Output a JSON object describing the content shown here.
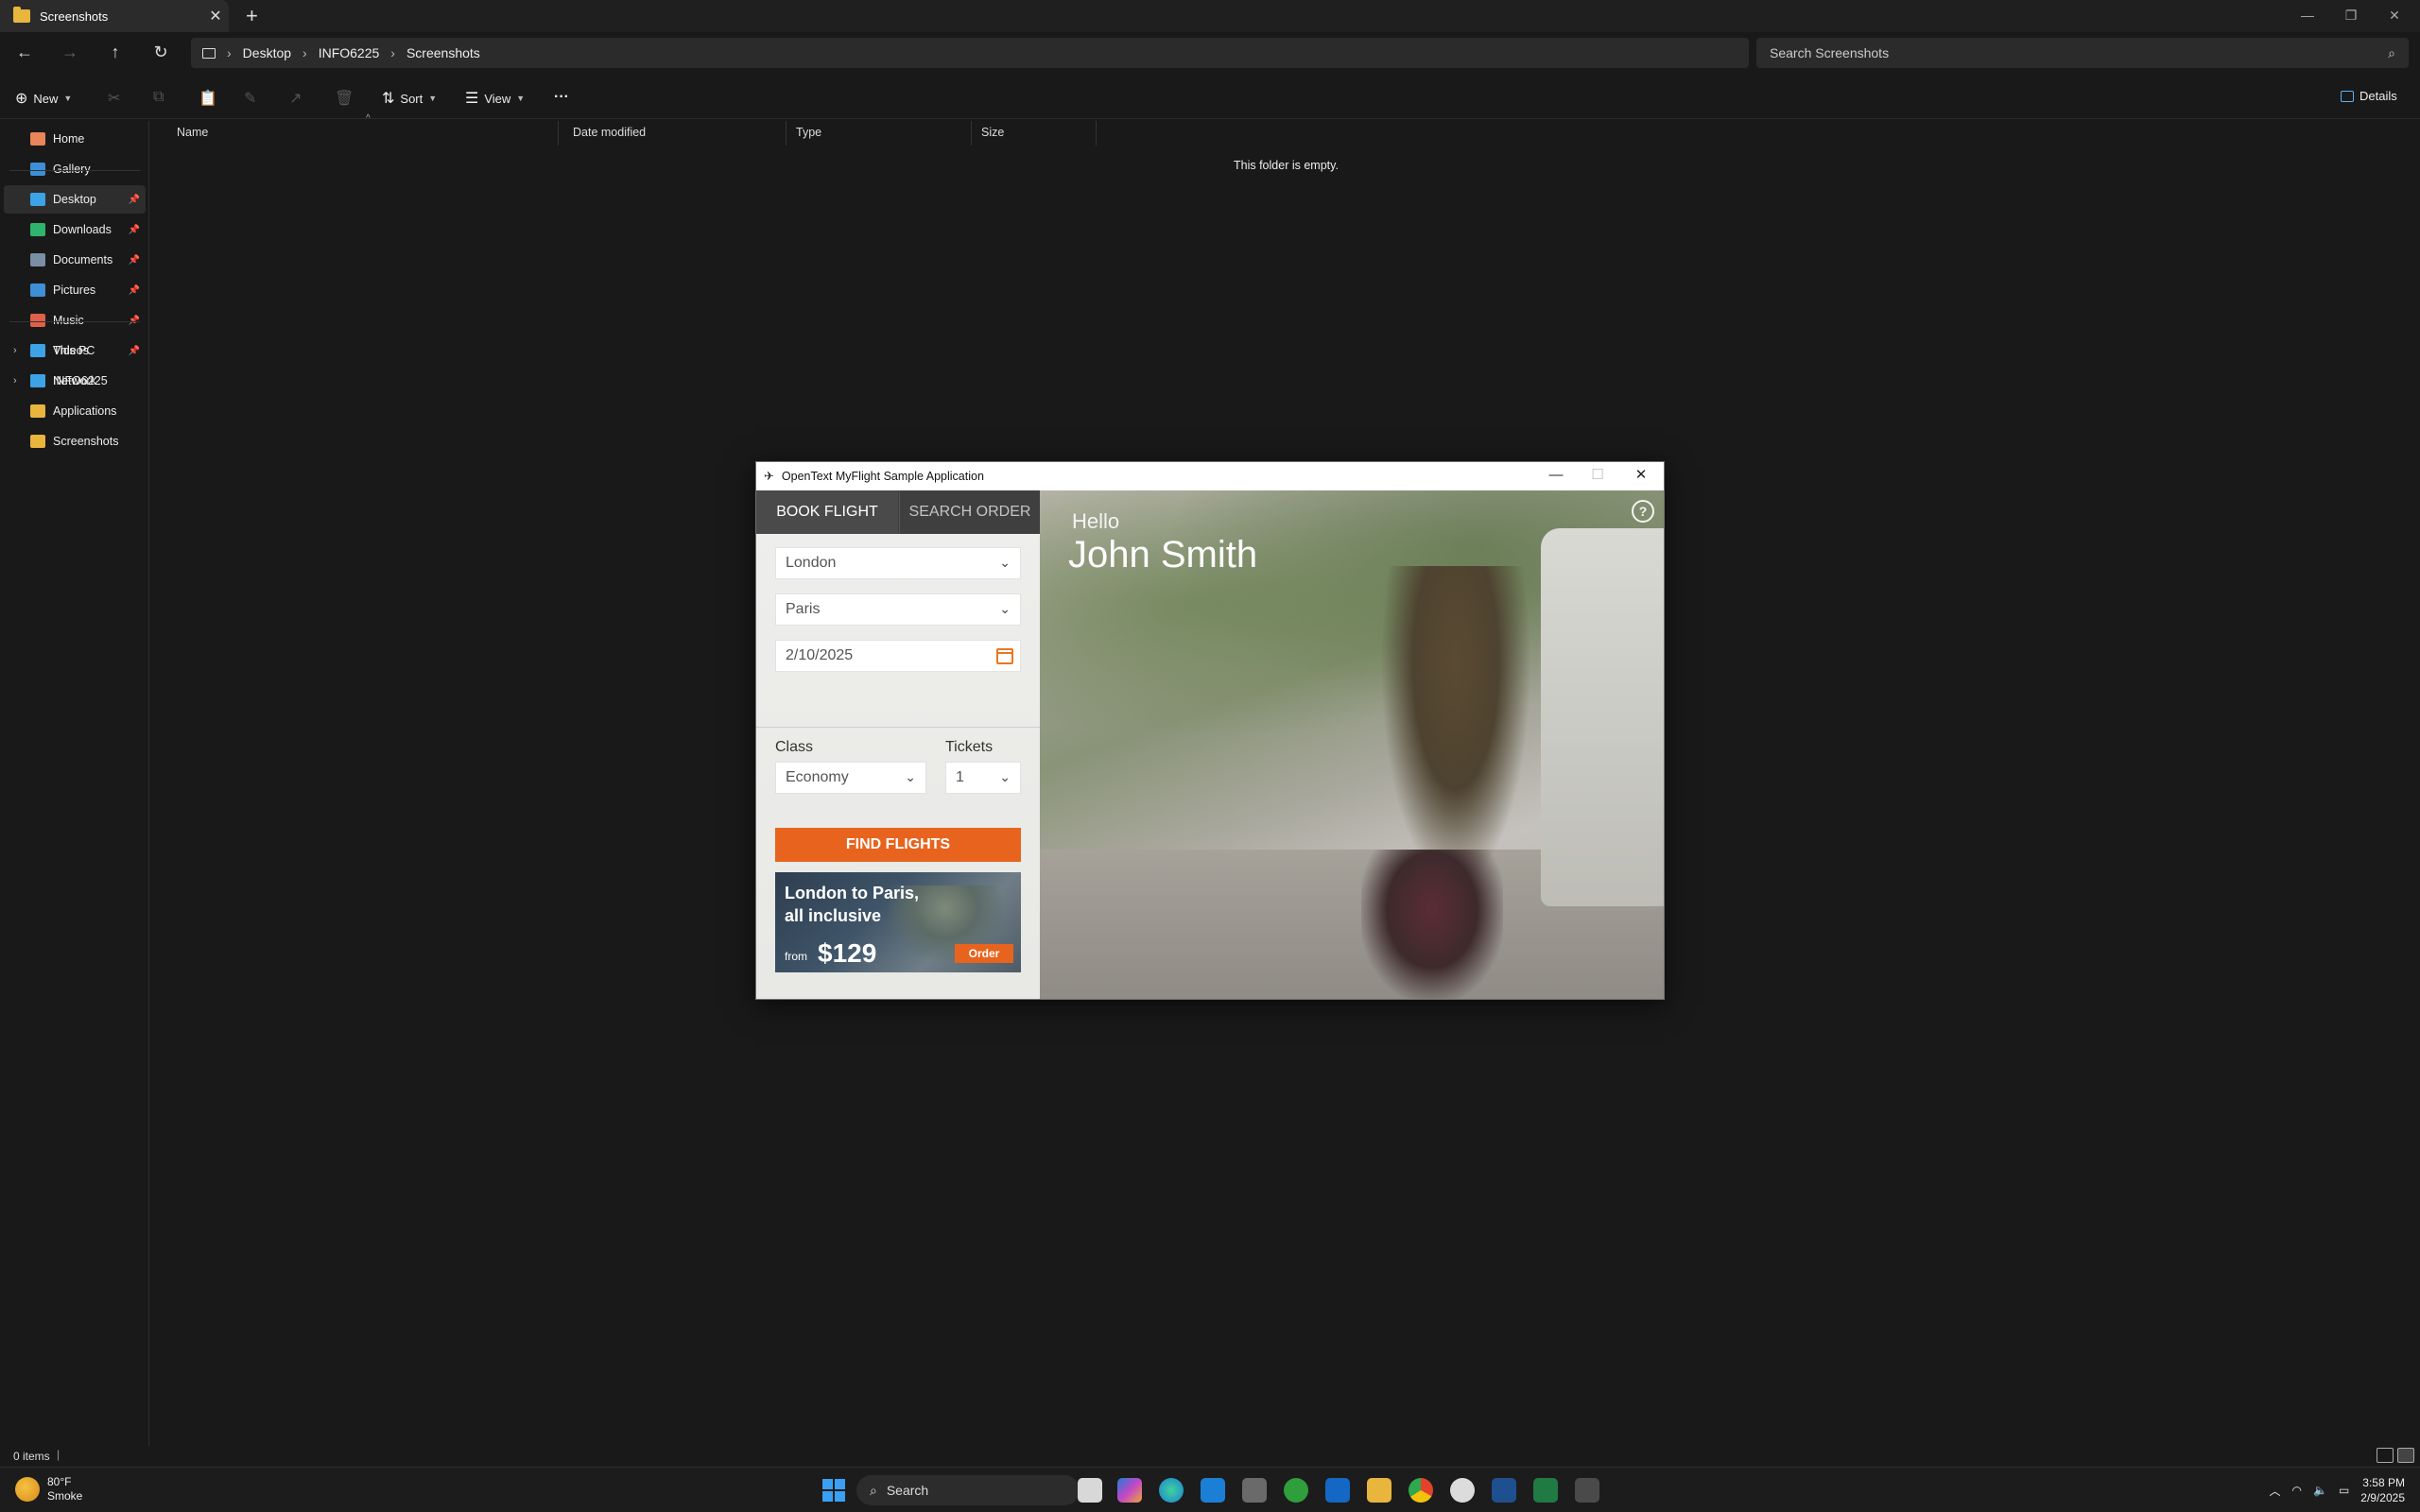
{
  "explorer": {
    "tab_title": "Screenshots",
    "new_tab_symbol": "+",
    "breadcrumb": [
      "Desktop",
      "INFO6225",
      "Screenshots"
    ],
    "search_placeholder": "Search Screenshots",
    "toolbar": {
      "new_label": "New",
      "sort_label": "Sort",
      "view_label": "View",
      "more_label": "···",
      "details_label": "Details"
    },
    "sidebar": {
      "top": [
        {
          "label": "Home",
          "icon": "home-icon",
          "color": "#e8855a"
        },
        {
          "label": "Gallery",
          "icon": "gallery-icon",
          "color": "#3d8fd6"
        }
      ],
      "pinned": [
        {
          "label": "Desktop",
          "icon": "desktop-icon",
          "color": "#3da2e6"
        },
        {
          "label": "Downloads",
          "icon": "download-icon",
          "color": "#2fb36e"
        },
        {
          "label": "Documents",
          "icon": "documents-icon",
          "color": "#7a8ea6"
        },
        {
          "label": "Pictures",
          "icon": "pictures-icon",
          "color": "#3d8fd6"
        },
        {
          "label": "Music",
          "icon": "music-icon",
          "color": "#e0604a"
        },
        {
          "label": "Videos",
          "icon": "videos-icon",
          "color": "#8a55d6"
        },
        {
          "label": "INFO6225",
          "icon": "folder-icon",
          "color": "#e8b53d"
        },
        {
          "label": "Applications",
          "icon": "folder-icon",
          "color": "#e8b53d"
        },
        {
          "label": "Screenshots",
          "icon": "folder-icon",
          "color": "#e8b53d"
        }
      ],
      "bottom": [
        {
          "label": "This PC",
          "icon": "pc-icon",
          "color": "#3da2e6"
        },
        {
          "label": "Network",
          "icon": "network-icon",
          "color": "#3da2e6"
        }
      ]
    },
    "columns": [
      "Name",
      "Date modified",
      "Type",
      "Size"
    ],
    "empty_message": "This folder is empty.",
    "status_items": "0 items"
  },
  "app": {
    "title": "OpenText MyFlight Sample Application",
    "tabs": {
      "book": "BOOK FLIGHT",
      "search": "SEARCH ORDER"
    },
    "from_city": "London",
    "to_city": "Paris",
    "date": "2/10/2025",
    "class_label": "Class",
    "class_value": "Economy",
    "tickets_label": "Tickets",
    "tickets_value": "1",
    "find_button": "FIND FLIGHTS",
    "promo": {
      "title_line1": "London to Paris,",
      "title_line2": "all inclusive",
      "from": "from",
      "price": "$129",
      "order": "Order"
    },
    "greeting": "Hello",
    "user_name": "John Smith",
    "help": "?",
    "accent_color": "#e8641e"
  },
  "taskbar": {
    "weather_temp": "80°F",
    "weather_desc": "Smoke",
    "search_label": "Search",
    "time": "3:58 PM",
    "date": "2/9/2025"
  }
}
